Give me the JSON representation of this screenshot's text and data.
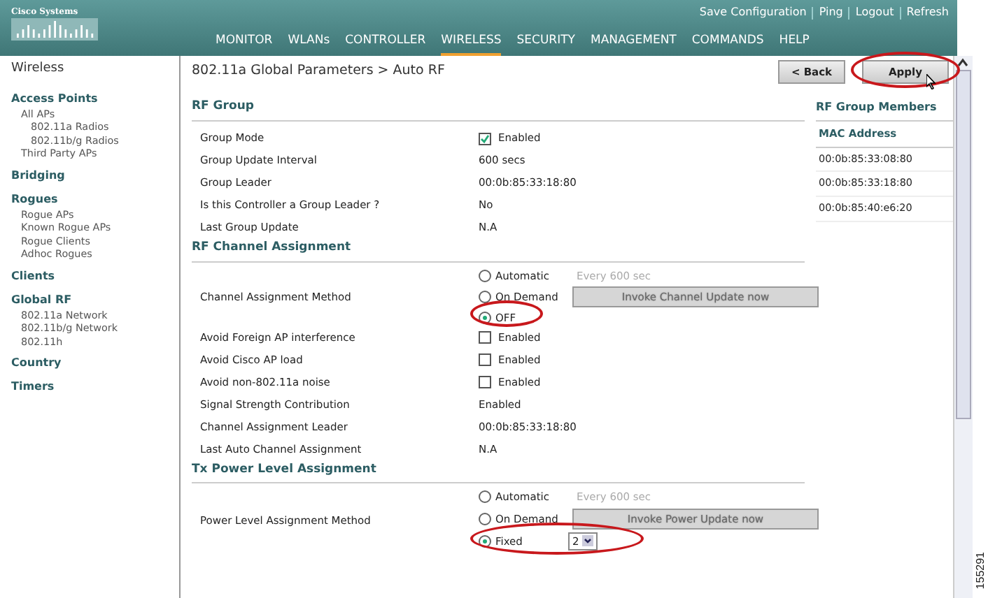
{
  "header": {
    "brand": "Cisco Systems",
    "links": [
      "Save Configuration",
      "Ping",
      "Logout",
      "Refresh"
    ],
    "menu": [
      {
        "label": "MONITOR",
        "selected": false
      },
      {
        "label": "WLANs",
        "selected": false
      },
      {
        "label": "CONTROLLER",
        "selected": false
      },
      {
        "label": "WIRELESS",
        "selected": true
      },
      {
        "label": "SECURITY",
        "selected": false
      },
      {
        "label": "MANAGEMENT",
        "selected": false
      },
      {
        "label": "COMMANDS",
        "selected": false
      },
      {
        "label": "HELP",
        "selected": false
      }
    ]
  },
  "sidebar": {
    "title": "Wireless",
    "sections": [
      {
        "label": "Access Points",
        "children": [
          {
            "label": "All APs",
            "children": [
              {
                "label": "802.11a Radios"
              },
              {
                "label": "802.11b/g Radios"
              }
            ]
          },
          {
            "label": "Third Party APs"
          }
        ]
      },
      {
        "label": "Bridging"
      },
      {
        "label": "Rogues",
        "children": [
          {
            "label": "Rogue APs"
          },
          {
            "label": "Known Rogue APs"
          },
          {
            "label": "Rogue Clients"
          },
          {
            "label": "Adhoc Rogues"
          }
        ]
      },
      {
        "label": "Clients"
      },
      {
        "label": "Global RF",
        "children": [
          {
            "label": "802.11a Network"
          },
          {
            "label": "802.11b/g Network"
          },
          {
            "label": "802.11h"
          }
        ]
      },
      {
        "label": "Country"
      },
      {
        "label": "Timers"
      }
    ]
  },
  "page": {
    "title": "802.11a Global Parameters > Auto RF",
    "buttons": [
      {
        "label": "< Back",
        "highlighted": false
      },
      {
        "label": "Apply",
        "highlighted": true
      }
    ]
  },
  "sections": [
    {
      "title": "RF Group",
      "rows": [
        {
          "kind": "checkbox",
          "label": "Group Mode",
          "checked": true,
          "value": "Enabled"
        },
        {
          "kind": "text",
          "label": "Group Update Interval",
          "value": "600 secs"
        },
        {
          "kind": "text",
          "label": "Group Leader",
          "value": "00:0b:85:33:18:80"
        },
        {
          "kind": "text",
          "label": "Is this Controller a Group Leader ?",
          "value": "No"
        },
        {
          "kind": "text",
          "label": "Last Group Update",
          "value": "N.A"
        }
      ]
    },
    {
      "title": "RF Channel Assignment",
      "rows": [
        {
          "kind": "radios",
          "label": "Channel Assignment Method",
          "options": [
            {
              "label": "Automatic",
              "selected": false,
              "highlighted": false,
              "note": "Every 600 sec"
            },
            {
              "label": "On Demand",
              "selected": false,
              "highlighted": false,
              "button": "Invoke Channel Update now"
            },
            {
              "label": "OFF",
              "selected": true,
              "highlighted": true
            }
          ]
        },
        {
          "kind": "checkbox",
          "label": "Avoid Foreign AP interference",
          "checked": false,
          "value": "Enabled"
        },
        {
          "kind": "checkbox",
          "label": "Avoid Cisco AP load",
          "checked": false,
          "value": "Enabled"
        },
        {
          "kind": "checkbox",
          "label": "Avoid non-802.11a noise",
          "checked": false,
          "value": "Enabled"
        },
        {
          "kind": "text",
          "label": "Signal Strength Contribution",
          "value": "Enabled"
        },
        {
          "kind": "text",
          "label": "Channel Assignment Leader",
          "value": "00:0b:85:33:18:80"
        },
        {
          "kind": "text",
          "label": "Last Auto Channel Assignment",
          "value": "N.A"
        }
      ]
    },
    {
      "title": "Tx Power Level Assignment",
      "rows": [
        {
          "kind": "radios",
          "label": "Power Level Assignment Method",
          "options": [
            {
              "label": "Automatic",
              "selected": false,
              "highlighted": false,
              "note": "Every 600 sec"
            },
            {
              "label": "On Demand",
              "selected": false,
              "highlighted": false,
              "button": "Invoke Power Update now"
            },
            {
              "label": "Fixed",
              "selected": true,
              "highlighted": true,
              "select": "2"
            }
          ]
        }
      ]
    }
  ],
  "members": {
    "title": "RF Group Members",
    "column": "MAC Address",
    "rows": [
      "00:0b:85:33:08:80",
      "00:0b:85:33:18:80",
      "00:0b:85:40:e6:20"
    ]
  },
  "figure_id": "155291"
}
